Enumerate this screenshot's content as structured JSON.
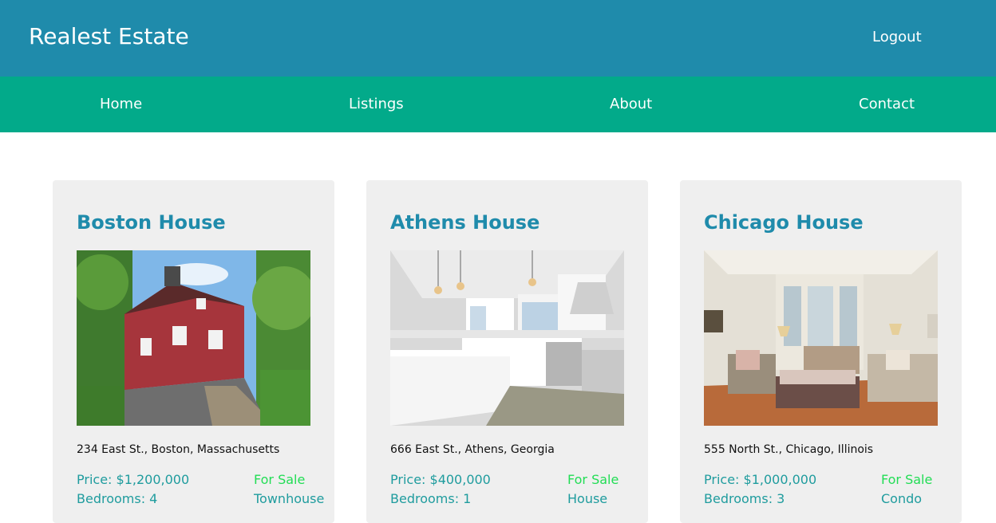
{
  "header": {
    "brand": "Realest Estate",
    "logout_label": "Logout"
  },
  "nav": {
    "items": [
      {
        "label": "Home"
      },
      {
        "label": "Listings"
      },
      {
        "label": "About"
      },
      {
        "label": "Contact"
      }
    ]
  },
  "listings": [
    {
      "title": "Boston House",
      "address": "234 East St., Boston, Massachusetts",
      "price": "Price: $1,200,000",
      "bedrooms": "Bedrooms: 4",
      "status": "For Sale",
      "type": "Townhouse"
    },
    {
      "title": "Athens House",
      "address": "666 East St., Athens, Georgia",
      "price": "Price: $400,000",
      "bedrooms": "Bedrooms: 1",
      "status": "For Sale",
      "type": "House"
    },
    {
      "title": "Chicago House",
      "address": "555 North St., Chicago, Illinois",
      "price": "Price: $1,000,000",
      "bedrooms": "Bedrooms: 3",
      "status": "For Sale",
      "type": "Condo"
    }
  ],
  "colors": {
    "header_bg": "#1f8bab",
    "nav_bg": "#02aa8a",
    "card_bg": "#efefef",
    "title": "#1f8bab",
    "detail": "#1f9c9e",
    "status": "#22dd55"
  }
}
